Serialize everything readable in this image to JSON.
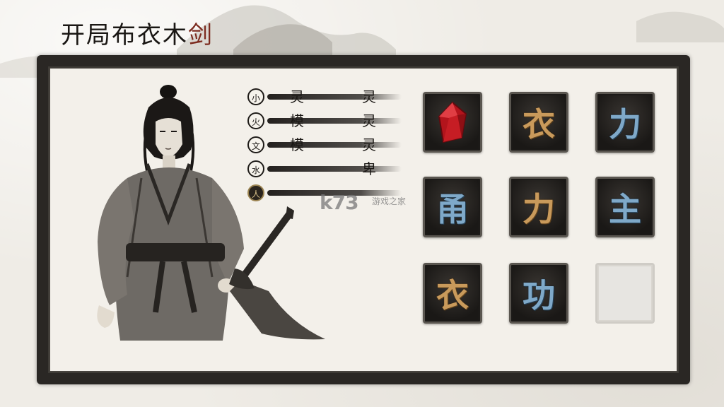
{
  "game": {
    "title_main": "开局布衣木",
    "title_accent": "剑"
  },
  "hero": {
    "name": "swordsman-portrait"
  },
  "stats": [
    {
      "icon_char": "小",
      "left": "灵",
      "right": "灵",
      "style": "plain"
    },
    {
      "icon_char": "火",
      "left": "模",
      "right": "灵",
      "style": "plain"
    },
    {
      "icon_char": "文",
      "left": "模",
      "right": "灵",
      "style": "plain"
    },
    {
      "icon_char": "水",
      "left": "",
      "right": "卑",
      "style": "plain"
    },
    {
      "icon_char": "人",
      "left": "",
      "right": "",
      "style": "gold"
    }
  ],
  "grid": {
    "tiles": [
      {
        "char": "",
        "color": "gem",
        "icon": "red-gem-icon"
      },
      {
        "char": "衣",
        "color": "gold"
      },
      {
        "char": "力",
        "color": "blue"
      },
      {
        "char": "甬",
        "color": "blue"
      },
      {
        "char": "力",
        "color": "gold"
      },
      {
        "char": "主",
        "color": "blue"
      },
      {
        "char": "衣",
        "color": "gold"
      },
      {
        "char": "功",
        "color": "blue"
      },
      {
        "char": "",
        "color": "empty"
      }
    ]
  },
  "watermark": {
    "logo": "k73",
    "sub": "游戏之家"
  },
  "colors": {
    "paper": "#efece6",
    "ink": "#1a1714",
    "accent_red": "#7c2b1f",
    "tile_gold": "#c99a5b",
    "tile_blue": "#7fa9c9"
  }
}
